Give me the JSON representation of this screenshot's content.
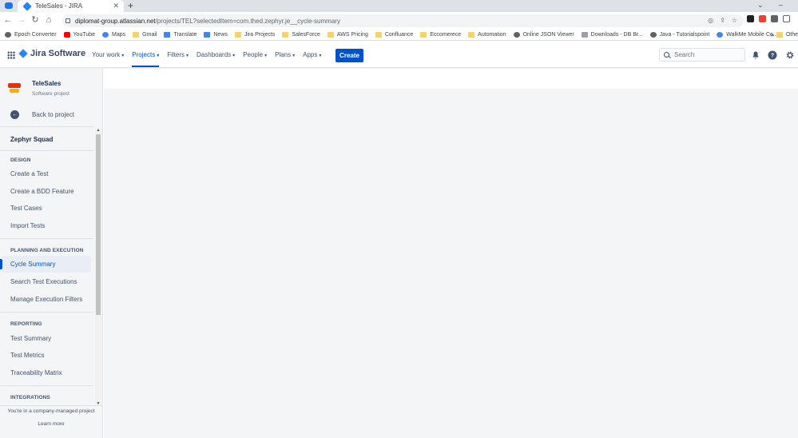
{
  "browser": {
    "tab_title": "TeleSales - JIRA",
    "url_host": "diplomat-group.atlassian.net",
    "url_path": "/projects/TEL?selectedItem=com.thed.zephyr.je__cycle-summary",
    "bookmarks": [
      {
        "label": "Epoch Converter",
        "icon": "globe-icon"
      },
      {
        "label": "YouTube",
        "icon": "youtube-icon"
      },
      {
        "label": "Maps",
        "icon": "maps-icon"
      },
      {
        "label": "Gmail",
        "icon": "gmail-icon"
      },
      {
        "label": "Translate",
        "icon": "translate-icon"
      },
      {
        "label": "News",
        "icon": "news-icon"
      },
      {
        "label": "Jira Projects",
        "icon": "folder-icon"
      },
      {
        "label": "SalesForce",
        "icon": "folder-icon"
      },
      {
        "label": "AWS Pricing",
        "icon": "folder-icon"
      },
      {
        "label": "Confluance",
        "icon": "folder-icon"
      },
      {
        "label": "Eccomerece",
        "icon": "folder-icon"
      },
      {
        "label": "Automation",
        "icon": "folder-icon"
      },
      {
        "label": "Online JSON Viewer",
        "icon": "globe-icon"
      },
      {
        "label": "Downloads - DB Br...",
        "icon": "page-icon"
      },
      {
        "label": "Java - Tutorialspoint",
        "icon": "globe-icon"
      },
      {
        "label": "WalkMe Mobile Co...",
        "icon": "walkme-icon"
      }
    ],
    "bookmarks_more": "»",
    "bookmarks_other": "Othe"
  },
  "topnav": {
    "product": "Jira Software",
    "menu": [
      {
        "label": "Your work",
        "active": false
      },
      {
        "label": "Projects",
        "active": true
      },
      {
        "label": "Filters",
        "active": false
      },
      {
        "label": "Dashboards",
        "active": false
      },
      {
        "label": "People",
        "active": false
      },
      {
        "label": "Plans",
        "active": false
      },
      {
        "label": "Apps",
        "active": false
      }
    ],
    "create_label": "Create",
    "search_placeholder": "Search"
  },
  "sidebar": {
    "project_name": "TeleSales",
    "project_type": "Software project",
    "back_label": "Back to project",
    "app_name": "Zephyr Squad",
    "sections": [
      {
        "title": "DESIGN",
        "items": [
          "Create a Test",
          "Create a BDD Feature",
          "Test Cases",
          "Import Tests"
        ]
      },
      {
        "title": "PLANNING AND EXECUTION",
        "items": [
          "Cycle Summary",
          "Search Test Executions",
          "Manage Execution Filters"
        ]
      },
      {
        "title": "REPORTING",
        "items": [
          "Test Summary",
          "Test Metrics",
          "Traceability Matrix"
        ]
      },
      {
        "title": "INTEGRATIONS",
        "items": []
      }
    ],
    "active_item": "Cycle Summary",
    "footer_note": "You're in a company-managed project",
    "footer_link": "Learn more"
  },
  "colors": {
    "brand_blue": "#0052cc",
    "sidebar_bg": "#f4f5f7",
    "text": "#172b4d"
  }
}
